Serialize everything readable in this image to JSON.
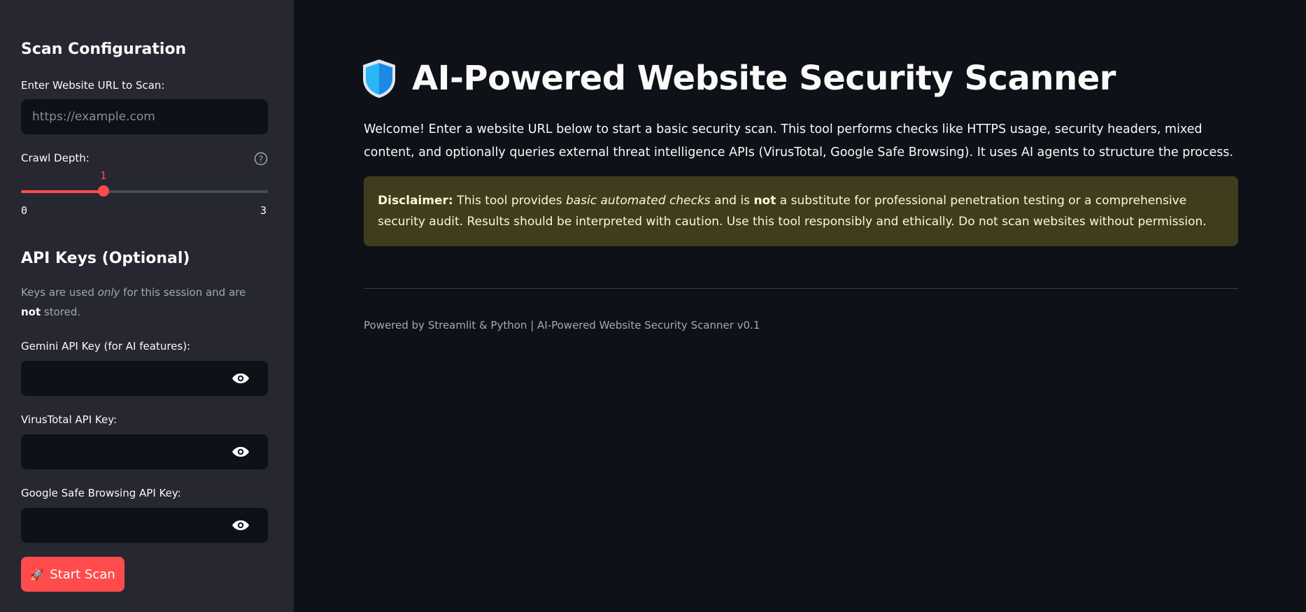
{
  "sidebar": {
    "scan_config_heading": "Scan Configuration",
    "url_label": "Enter Website URL to Scan:",
    "url_placeholder": "https://example.com",
    "url_value": "",
    "crawl_label": "Crawl Depth:",
    "crawl_value": "1",
    "crawl_min": "0",
    "crawl_max": "3",
    "crawl_fraction": 0.3333,
    "api_heading": "API Keys (Optional)",
    "caption": {
      "part1": "Keys are used ",
      "em": "only",
      "part2": " for this session and are ",
      "strong": "not",
      "part3": " stored."
    },
    "gemini_label": "Gemini API Key (for AI features):",
    "virustotal_label": "VirusTotal API Key:",
    "safebrowsing_label": "Google Safe Browsing API Key:",
    "start_button_icon": "🚀",
    "start_button_label": "Start Scan"
  },
  "main": {
    "title": "AI-Powered Website Security Scanner",
    "intro": "Welcome! Enter a website URL below to start a basic security scan. This tool performs checks like HTTPS usage, security headers, mixed content, and optionally queries external threat intelligence APIs (VirusTotal, Google Safe Browsing). It uses AI agents to structure the process.",
    "disclaimer": {
      "label": "Disclaimer:",
      "part1": " This tool provides ",
      "em": "basic automated checks",
      "part2": " and is ",
      "strong": "not",
      "part3": " a substitute for professional penetration testing or a comprehensive security audit. Results should be interpreted with caution. Use this tool responsibly and ethically. Do not scan websites without permission."
    },
    "footer": "Powered by Streamlit & Python | AI-Powered Website Security Scanner v0.1"
  },
  "colors": {
    "accent": "#ff4b4b",
    "sidebar_bg": "#262730",
    "main_bg": "#0e1117",
    "warning_bg": "#3f3d1d",
    "warning_text": "#fdfad0"
  }
}
